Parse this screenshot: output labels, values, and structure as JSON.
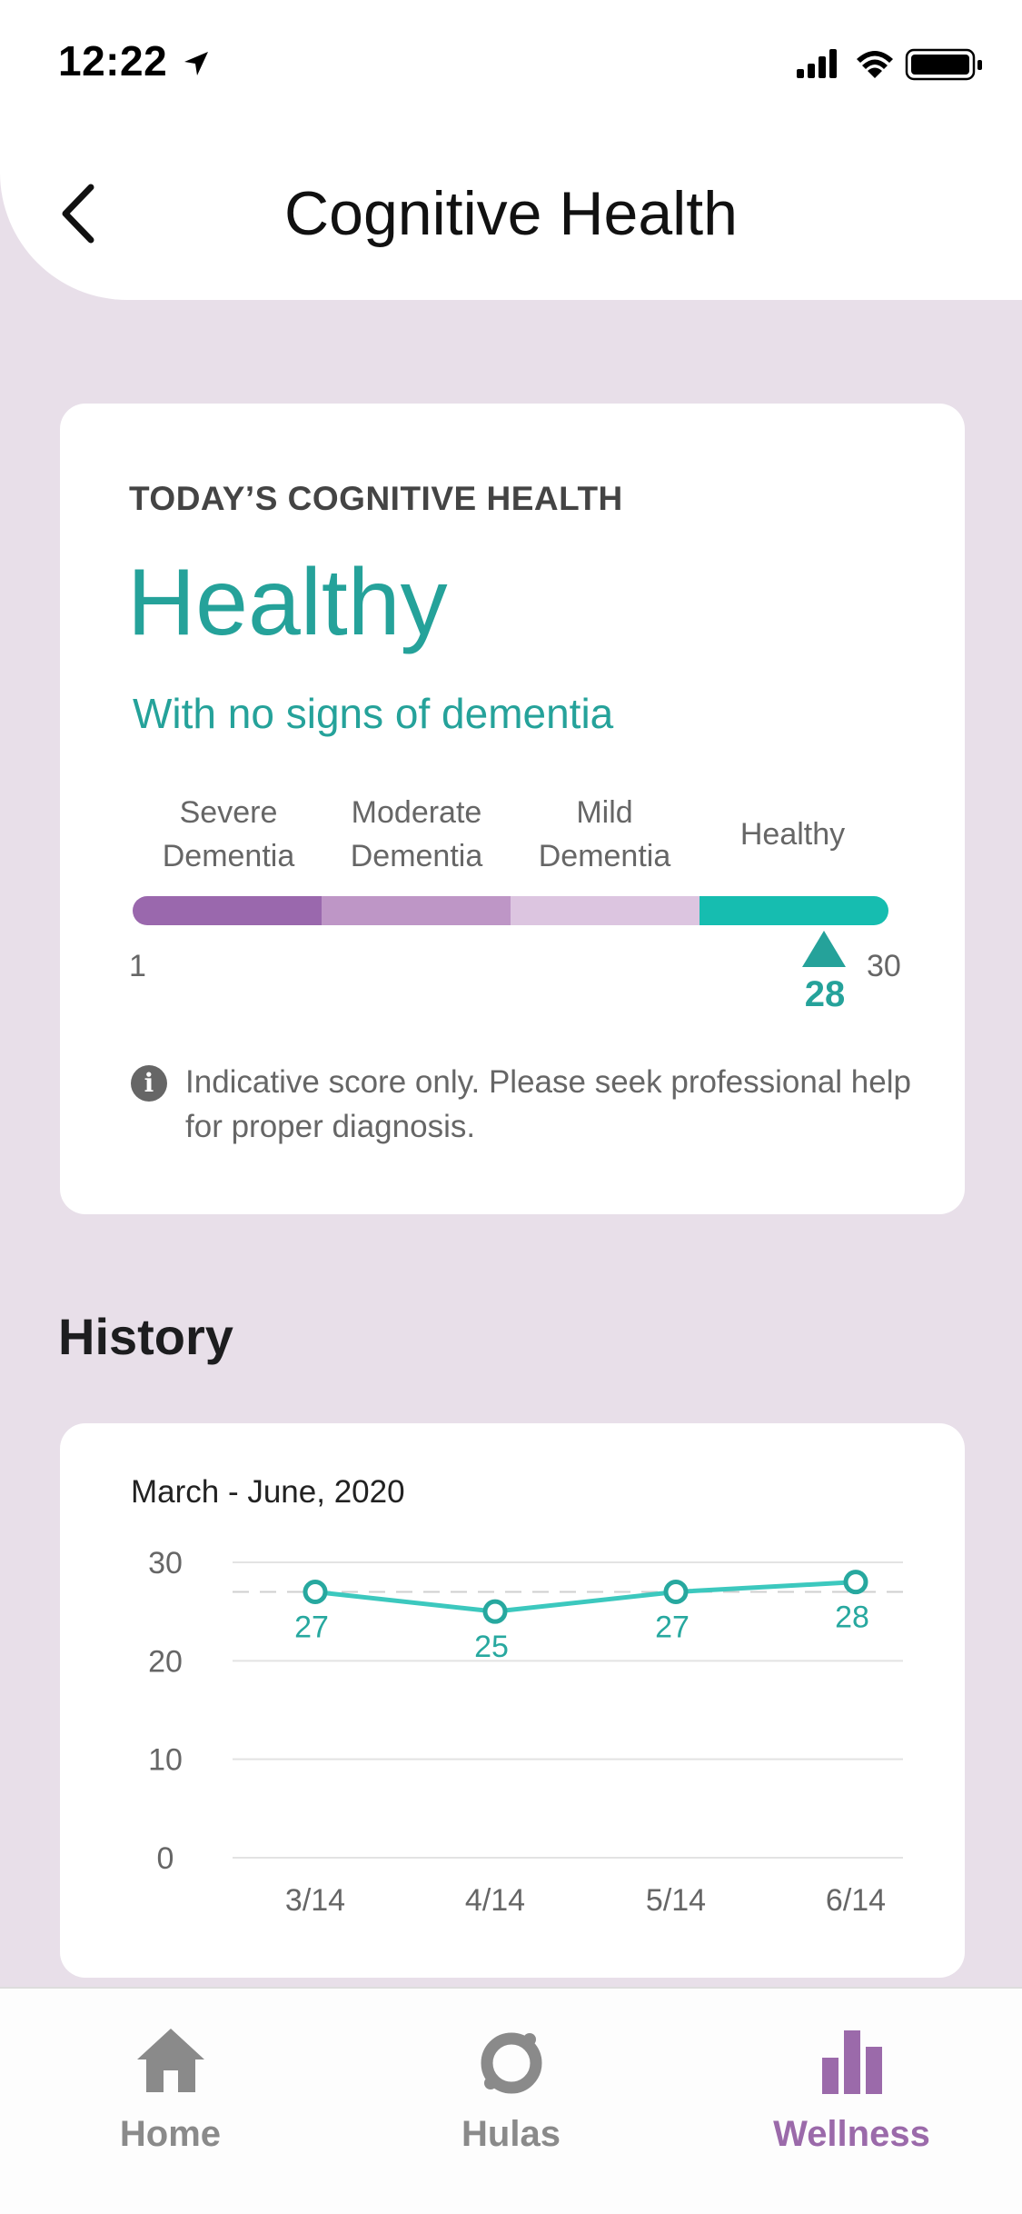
{
  "status_bar": {
    "time": "12:22"
  },
  "header": {
    "title": "Cognitive Health"
  },
  "today": {
    "section_label": "TODAY’S COGNITIVE HEALTH",
    "status": "Healthy",
    "subtitle": "With no signs of dementia",
    "scale": {
      "labels": [
        "Severe\nDementia",
        "Moderate\nDementia",
        "Mild\nDementia",
        "Healthy"
      ],
      "colors": [
        "#9a68ad",
        "#be96c6",
        "#dcc5e0",
        "#16bdb0"
      ],
      "min": "1",
      "max": "30",
      "score": "28",
      "score_value": 28
    },
    "disclaimer": "Indicative score only. Please seek professional help for proper diagnosis."
  },
  "history": {
    "title": "History",
    "date_range": "March - June, 2020"
  },
  "chart_data": {
    "type": "line",
    "categories": [
      "3/14",
      "4/14",
      "5/14",
      "6/14"
    ],
    "values": [
      27,
      25,
      27,
      28
    ],
    "data_labels": [
      "27",
      "25",
      "27",
      "28"
    ],
    "y_ticks": [
      "30",
      "20",
      "10",
      "0"
    ],
    "ylim": [
      0,
      30
    ],
    "reference_line": 27,
    "grid": true,
    "line_color": "#3cc8be"
  },
  "tab_bar": {
    "tabs": [
      {
        "label": "Home",
        "icon": "home-icon",
        "active": false
      },
      {
        "label": "Hulas",
        "icon": "hula-ring-icon",
        "active": false
      },
      {
        "label": "Wellness",
        "icon": "bar-chart-icon",
        "active": true
      }
    ],
    "active_color": "#9b6aaa",
    "inactive_color": "#8a8a8a"
  }
}
